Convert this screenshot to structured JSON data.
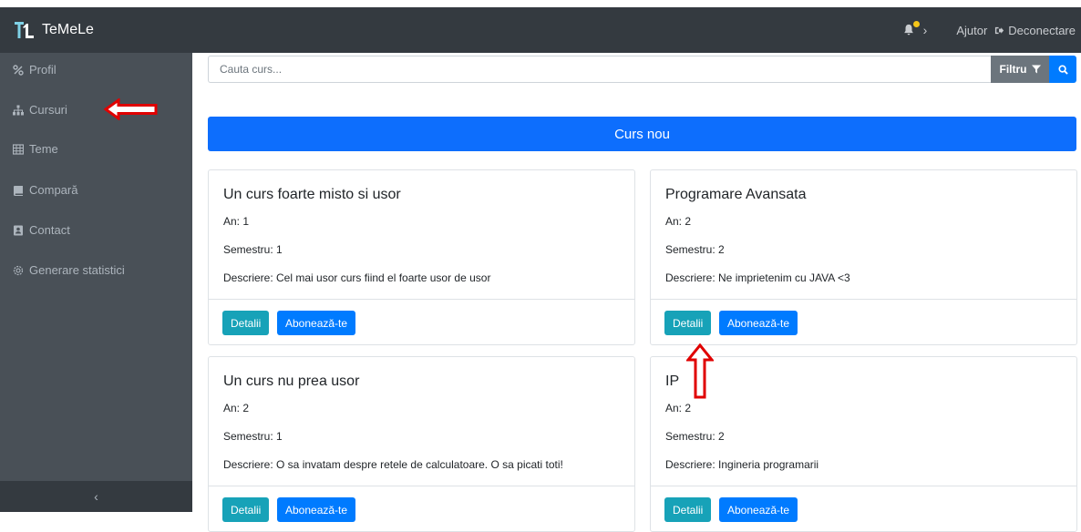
{
  "app": {
    "title": "TeMeLe"
  },
  "header": {
    "help": "Ajutor",
    "logout": "Deconectare"
  },
  "sidebar": {
    "items": [
      {
        "label": "Profil",
        "icon": "percent-icon"
      },
      {
        "label": "Cursuri",
        "icon": "sitemap-icon"
      },
      {
        "label": "Teme",
        "icon": "table-icon"
      },
      {
        "label": "Compară",
        "icon": "book-icon"
      },
      {
        "label": "Contact",
        "icon": "address-book-icon"
      },
      {
        "label": "Generare statistici",
        "icon": "cog-icon"
      }
    ],
    "collapse_symbol": "‹"
  },
  "search": {
    "placeholder": "Cauta curs...",
    "filter_label": "Filtru"
  },
  "new_course_label": "Curs nou",
  "courses": [
    {
      "title": "Un curs foarte misto si usor",
      "year": "An: 1",
      "semester": "Semestru: 1",
      "description": "Descriere: Cel mai usor curs fiind el foarte usor de usor",
      "details": "Detalii",
      "subscribe": "Abonează-te"
    },
    {
      "title": "Programare Avansata",
      "year": "An: 2",
      "semester": "Semestru: 2",
      "description": "Descriere: Ne imprietenim cu JAVA <3",
      "details": "Detalii",
      "subscribe": "Abonează-te"
    },
    {
      "title": "Un curs nu prea usor",
      "year": "An: 2",
      "semester": "Semestru: 1",
      "description": "Descriere: O sa invatam despre retele de calculatoare. O sa picati toti!",
      "details": "Detalii",
      "subscribe": "Abonează-te"
    },
    {
      "title": "IP",
      "year": "An: 2",
      "semester": "Semestru: 2",
      "description": "Descriere: Ingineria programarii",
      "details": "Detalii",
      "subscribe": "Abonează-te"
    }
  ],
  "colors": {
    "topbar": "#343a40",
    "sidebar": "#495057",
    "primary": "#007bff",
    "info": "#17a2b8",
    "annotation": "#e00000"
  }
}
